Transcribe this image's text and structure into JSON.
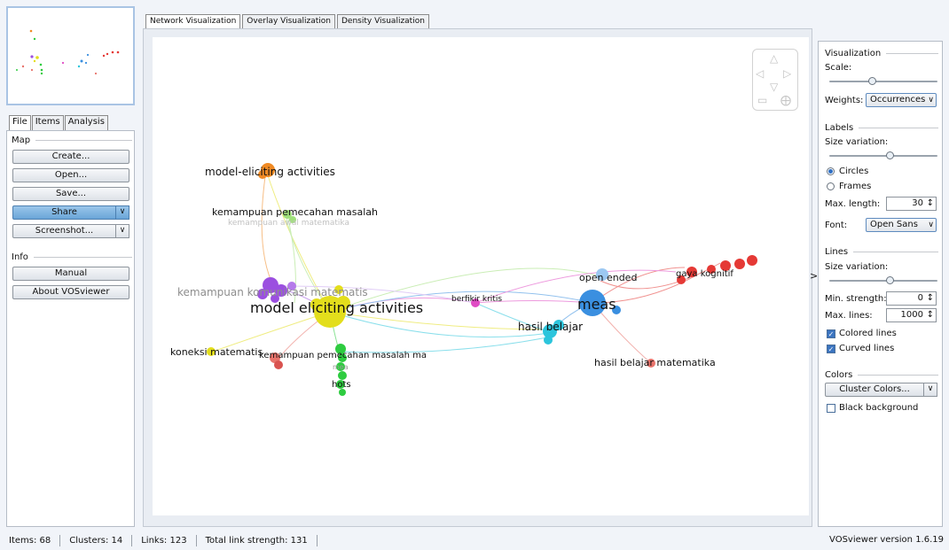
{
  "left_tabs": [
    "File",
    "Items",
    "Analysis"
  ],
  "map_section": {
    "title": "Map",
    "create": "Create...",
    "open": "Open...",
    "save": "Save...",
    "share": "Share",
    "screenshot": "Screenshot..."
  },
  "info_section": {
    "title": "Info",
    "manual": "Manual",
    "about": "About VOSviewer"
  },
  "top_tabs": [
    "Network Visualization",
    "Overlay Visualization",
    "Density Visualization"
  ],
  "network": {
    "labels": {
      "model_eliciting_activities_top": "model-eliciting activities",
      "kemampuan_pemecahan_masalah": "kemampuan pemecahan masalah",
      "kemampuan_awal_matematika": "kemampuan awal matematika",
      "kemampuan_komunikasi": "kemampuan komunikasi matematis",
      "model_eliciting_activities_main": "model eliciting activities",
      "koneksi_matematis": "koneksi matematis",
      "kemampuan_pemecahan_ma": "kemampuan pemecahan masalah ma",
      "mea": "mea",
      "hots": "hots",
      "berfikir_kritis": "berfikir kritis",
      "hasil_belajar": "hasil belajar",
      "meas": "meas",
      "open_ended": "open ended",
      "gaya_kognitif": "gaya kognitif",
      "hasil_belajar_matematika": "hasil belajar matematika"
    },
    "cluster_colors": {
      "red": "#e53935",
      "green": "#2ecc40",
      "blue": "#3a8fe0",
      "yellow": "#e3de1c",
      "purple": "#9b4fe0",
      "cyan": "#2cc5dc",
      "orange": "#f08a24",
      "pink": "#e04ac4",
      "salmon": "#e8736b",
      "lightgreen": "#9fe07a"
    }
  },
  "right_panel": {
    "visualization": {
      "title": "Visualization",
      "scale_label": "Scale:",
      "weights_label": "Weights:",
      "weights_value": "Occurrences"
    },
    "labels": {
      "title": "Labels",
      "size_variation_label": "Size variation:",
      "circles": "Circles",
      "frames": "Frames",
      "max_length_label": "Max. length:",
      "max_length_value": "30",
      "font_label": "Font:",
      "font_value": "Open Sans"
    },
    "lines": {
      "title": "Lines",
      "size_variation_label": "Size variation:",
      "min_strength_label": "Min. strength:",
      "min_strength_value": "0",
      "max_lines_label": "Max. lines:",
      "max_lines_value": "1000",
      "colored_lines": "Colored lines",
      "curved_lines": "Curved lines"
    },
    "colors": {
      "title": "Colors",
      "cluster_colors": "Cluster Colors...",
      "black_background": "Black background"
    }
  },
  "status": {
    "items": "Items: 68",
    "clusters": "Clusters: 14",
    "links": "Links: 123",
    "total_link_strength": "Total link strength: 131",
    "version": "VOSviewer version 1.6.19"
  }
}
